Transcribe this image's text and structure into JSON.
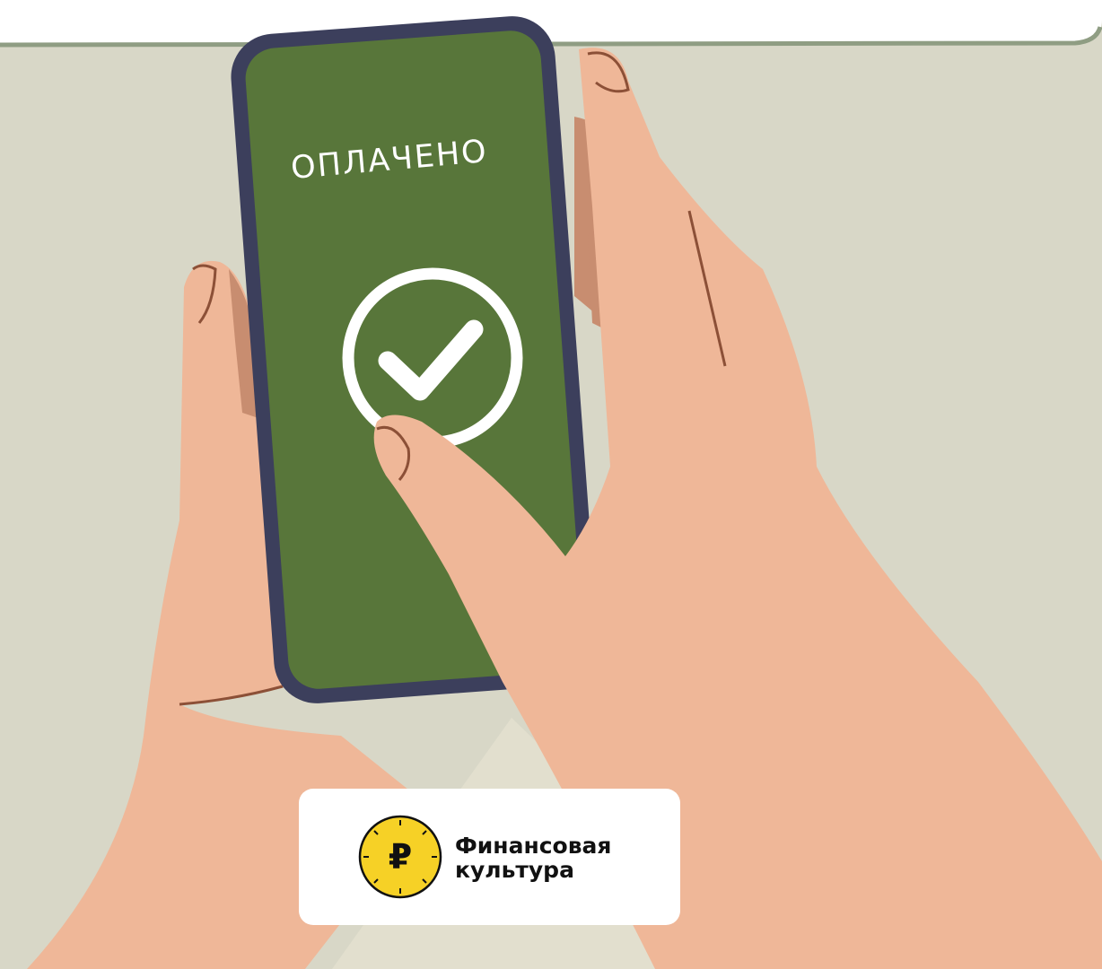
{
  "screen": {
    "status_text": "ОПЛАЧЕНО"
  },
  "logo": {
    "line1": "Финансовая",
    "line2": "культура",
    "currency_symbol": "₽"
  },
  "icons": [
    "check-circle-icon",
    "ruble-coin-icon"
  ],
  "colors": {
    "background": "#d8d7c7",
    "phone_screen": "#58763a",
    "phone_frame": "#3c3f5c",
    "skin": "#efb798",
    "coin": "#f6d126"
  }
}
